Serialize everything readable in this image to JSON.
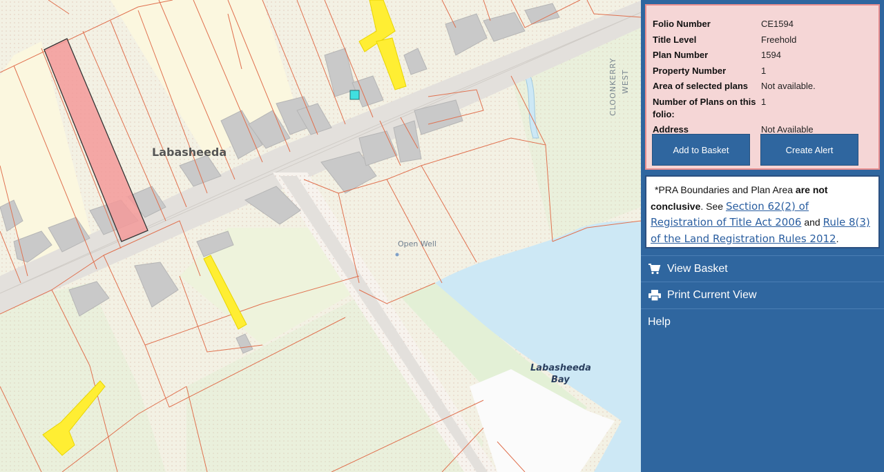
{
  "map": {
    "place_label": "Labasheeda",
    "bay_label_line1": "Labasheeda",
    "bay_label_line2": "Bay",
    "feature_label": "Open Well",
    "road_label_line1": "CLOONKERRY",
    "road_label_line2": "WEST",
    "colors": {
      "background": "#f3f1e4",
      "parcel_line": "#e0704e",
      "building": "#c9c9c9",
      "road": "#e6e3df",
      "water": "#cde8f5",
      "selected_parcel": "#f39a9a",
      "highlight": "#ffee33",
      "marker": "#40e0e0"
    }
  },
  "panel": {
    "info": {
      "rows": [
        {
          "label": "Folio Number",
          "value": "CE1594"
        },
        {
          "label": "Title Level",
          "value": "Freehold"
        },
        {
          "label": "Plan Number",
          "value": "1594"
        },
        {
          "label": "Property Number",
          "value": "1"
        },
        {
          "label": "Area of selected plans",
          "value": "Not available."
        },
        {
          "label": "Number of Plans on this folio:",
          "value": "1"
        },
        {
          "label": "Address",
          "value": "Not Available"
        }
      ],
      "add_basket_label": "Add to Basket",
      "create_alert_label": "Create Alert"
    },
    "notice": {
      "prefix": "*PRA Boundaries and Plan Area ",
      "bold": "are not conclusive",
      "see": ". See ",
      "link1": "Section 62(2) of Registration of Title Act 2006",
      "and": " and ",
      "link2": "Rule 8(3) of the Land Registration Rules 2012",
      "end": "."
    },
    "menu": {
      "view_basket": "View Basket",
      "print_view": "Print Current View",
      "help": "Help"
    },
    "colors": {
      "panel_bg": "#2f669f",
      "info_bg": "#f5d6d6",
      "info_border": "#e98e8e"
    }
  }
}
